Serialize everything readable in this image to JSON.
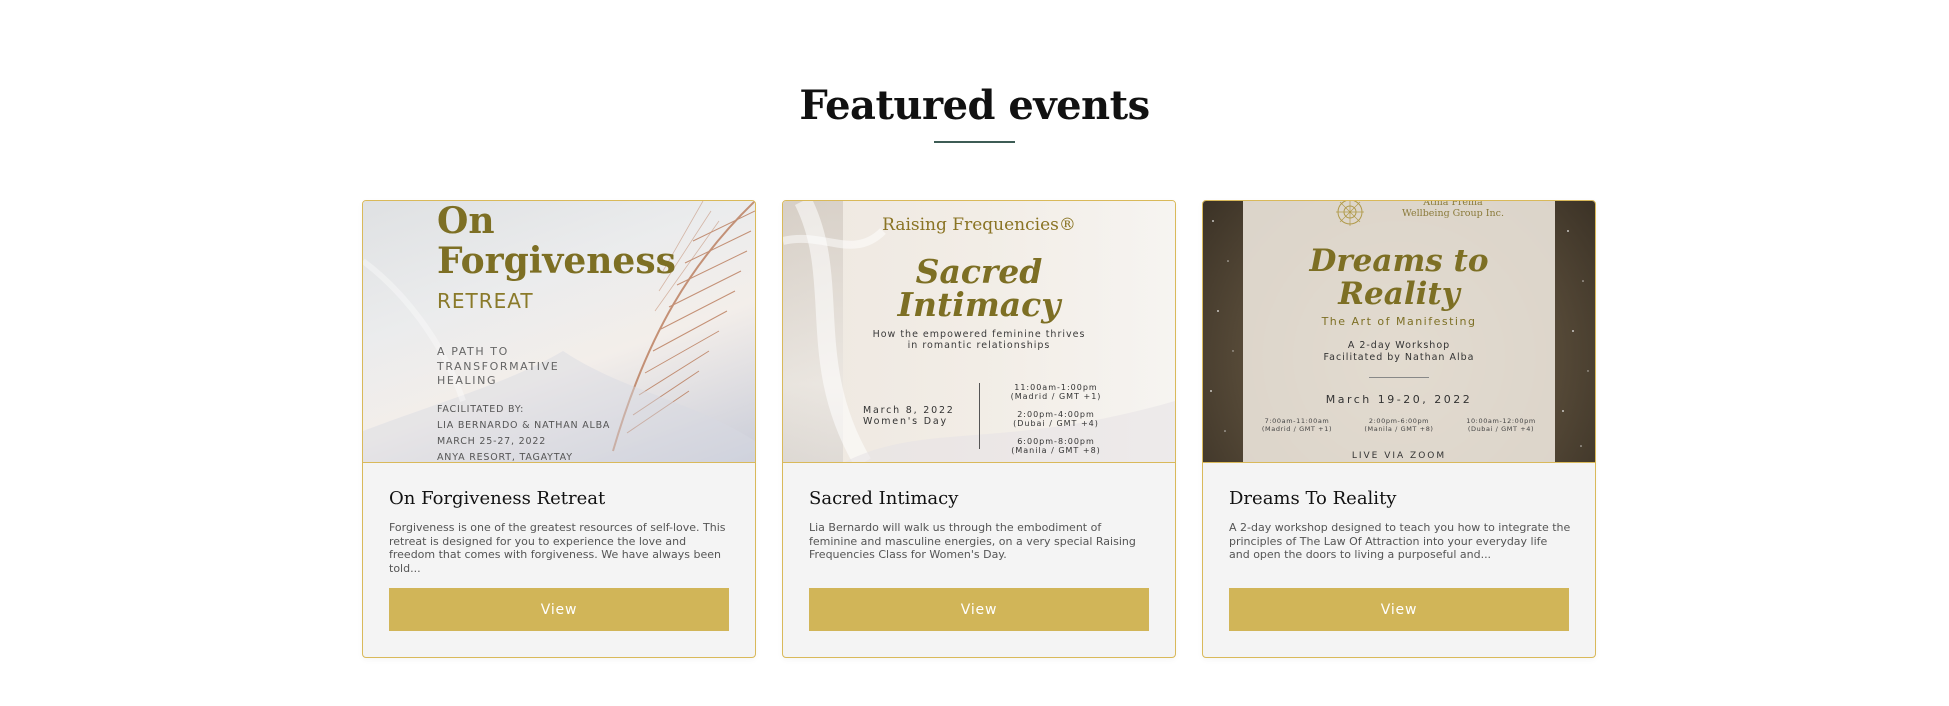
{
  "section": {
    "heading": "Featured events"
  },
  "events": [
    {
      "title": "On Forgiveness Retreat",
      "description": "Forgiveness is one of the greatest resources of self-love. This retreat is designed for you to experience the love and freedom that comes with forgiveness. We have always been told...",
      "button_label": "View",
      "poster": {
        "title_line1": "On",
        "title_line2": "Forgiveness",
        "subtitle": "RETREAT",
        "tagline": "A PATH TO\nTRANSFORMATIVE\nHEALING",
        "details": "FACILITATED BY:\nLIA BERNARDO & NATHAN ALBA\nMARCH 25-27, 2022\nANYA RESORT, TAGAYTAY"
      }
    },
    {
      "title": "Sacred Intimacy",
      "description": "Lia Bernardo will walk us through the embodiment of feminine and masculine energies, on a very special Raising Frequencies Class for Women's Day.",
      "button_label": "View",
      "poster": {
        "brand": "Raising Frequencies®",
        "title": "Sacred\nIntimacy",
        "subtitle": "How the empowered feminine thrives\nin romantic relationships",
        "date": "March 8, 2022\nWomen's Day",
        "times": "11:00am-1:00pm\n(Madrid / GMT +1)\n\n2:00pm-4:00pm\n(Dubai / GMT +4)\n\n6:00pm-8:00pm\n(Manila / GMT +8)"
      }
    },
    {
      "title": "Dreams To Reality",
      "description": "A 2-day workshop designed to teach you how to integrate the principles of The Law Of Attraction into your everyday life and open the doors to living a purposeful and...",
      "button_label": "View",
      "poster": {
        "org": "Atma Prema\nWellbeing Group Inc.",
        "title": "Dreams to\nReality",
        "subtitle": "The Art of Manifesting",
        "workshop": "A 2-day Workshop\nFacilitated by Nathan Alba",
        "date": "March 19-20, 2022",
        "time1": "7:00am-11:00am\n(Madrid / GMT +1)",
        "time2": "2:00pm-6:00pm\n(Manila / GMT +8)",
        "time3": "10:00am-12:00pm\n(Dubai / GMT +4)",
        "footer": "LIVE VIA ZOOM"
      }
    }
  ],
  "colors": {
    "accent_gold": "#d1b558",
    "card_border": "#d9b95a",
    "heading_rule": "#3d5c55",
    "poster_olive": "#7d6f24"
  }
}
